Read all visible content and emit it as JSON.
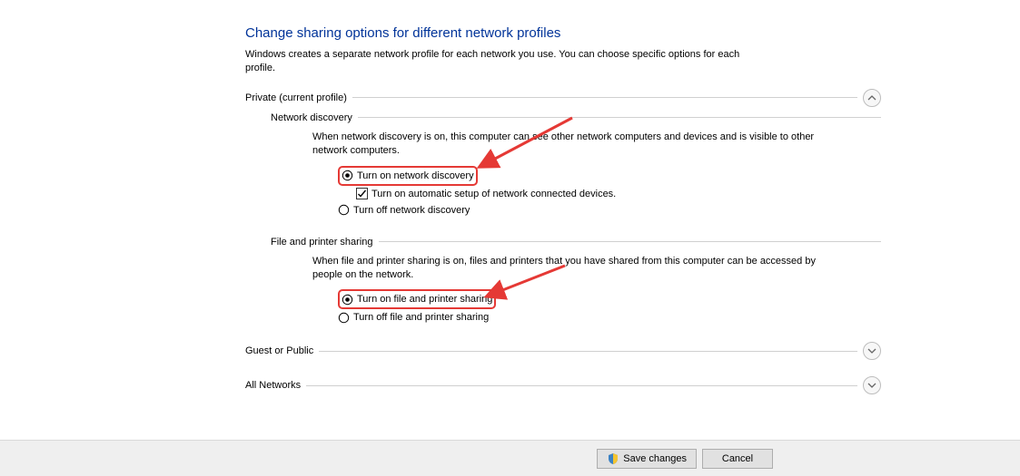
{
  "title": "Change sharing options for different network profiles",
  "description": "Windows creates a separate network profile for each network you use. You can choose specific options for each profile.",
  "sections": {
    "private": {
      "label": "Private (current profile)",
      "networkDiscovery": {
        "heading": "Network discovery",
        "text": "When network discovery is on, this computer can see other network computers and devices and is visible to other network computers.",
        "optOn": "Turn on network discovery",
        "optAuto": "Turn on automatic setup of network connected devices.",
        "optOff": "Turn off network discovery"
      },
      "filePrinter": {
        "heading": "File and printer sharing",
        "text": "When file and printer sharing is on, files and printers that you have shared from this computer can be accessed by people on the network.",
        "optOn": "Turn on file and printer sharing",
        "optOff": "Turn off file and printer sharing"
      }
    },
    "guest": {
      "label": "Guest or Public"
    },
    "all": {
      "label": "All Networks"
    }
  },
  "buttons": {
    "save": "Save changes",
    "cancel": "Cancel"
  }
}
